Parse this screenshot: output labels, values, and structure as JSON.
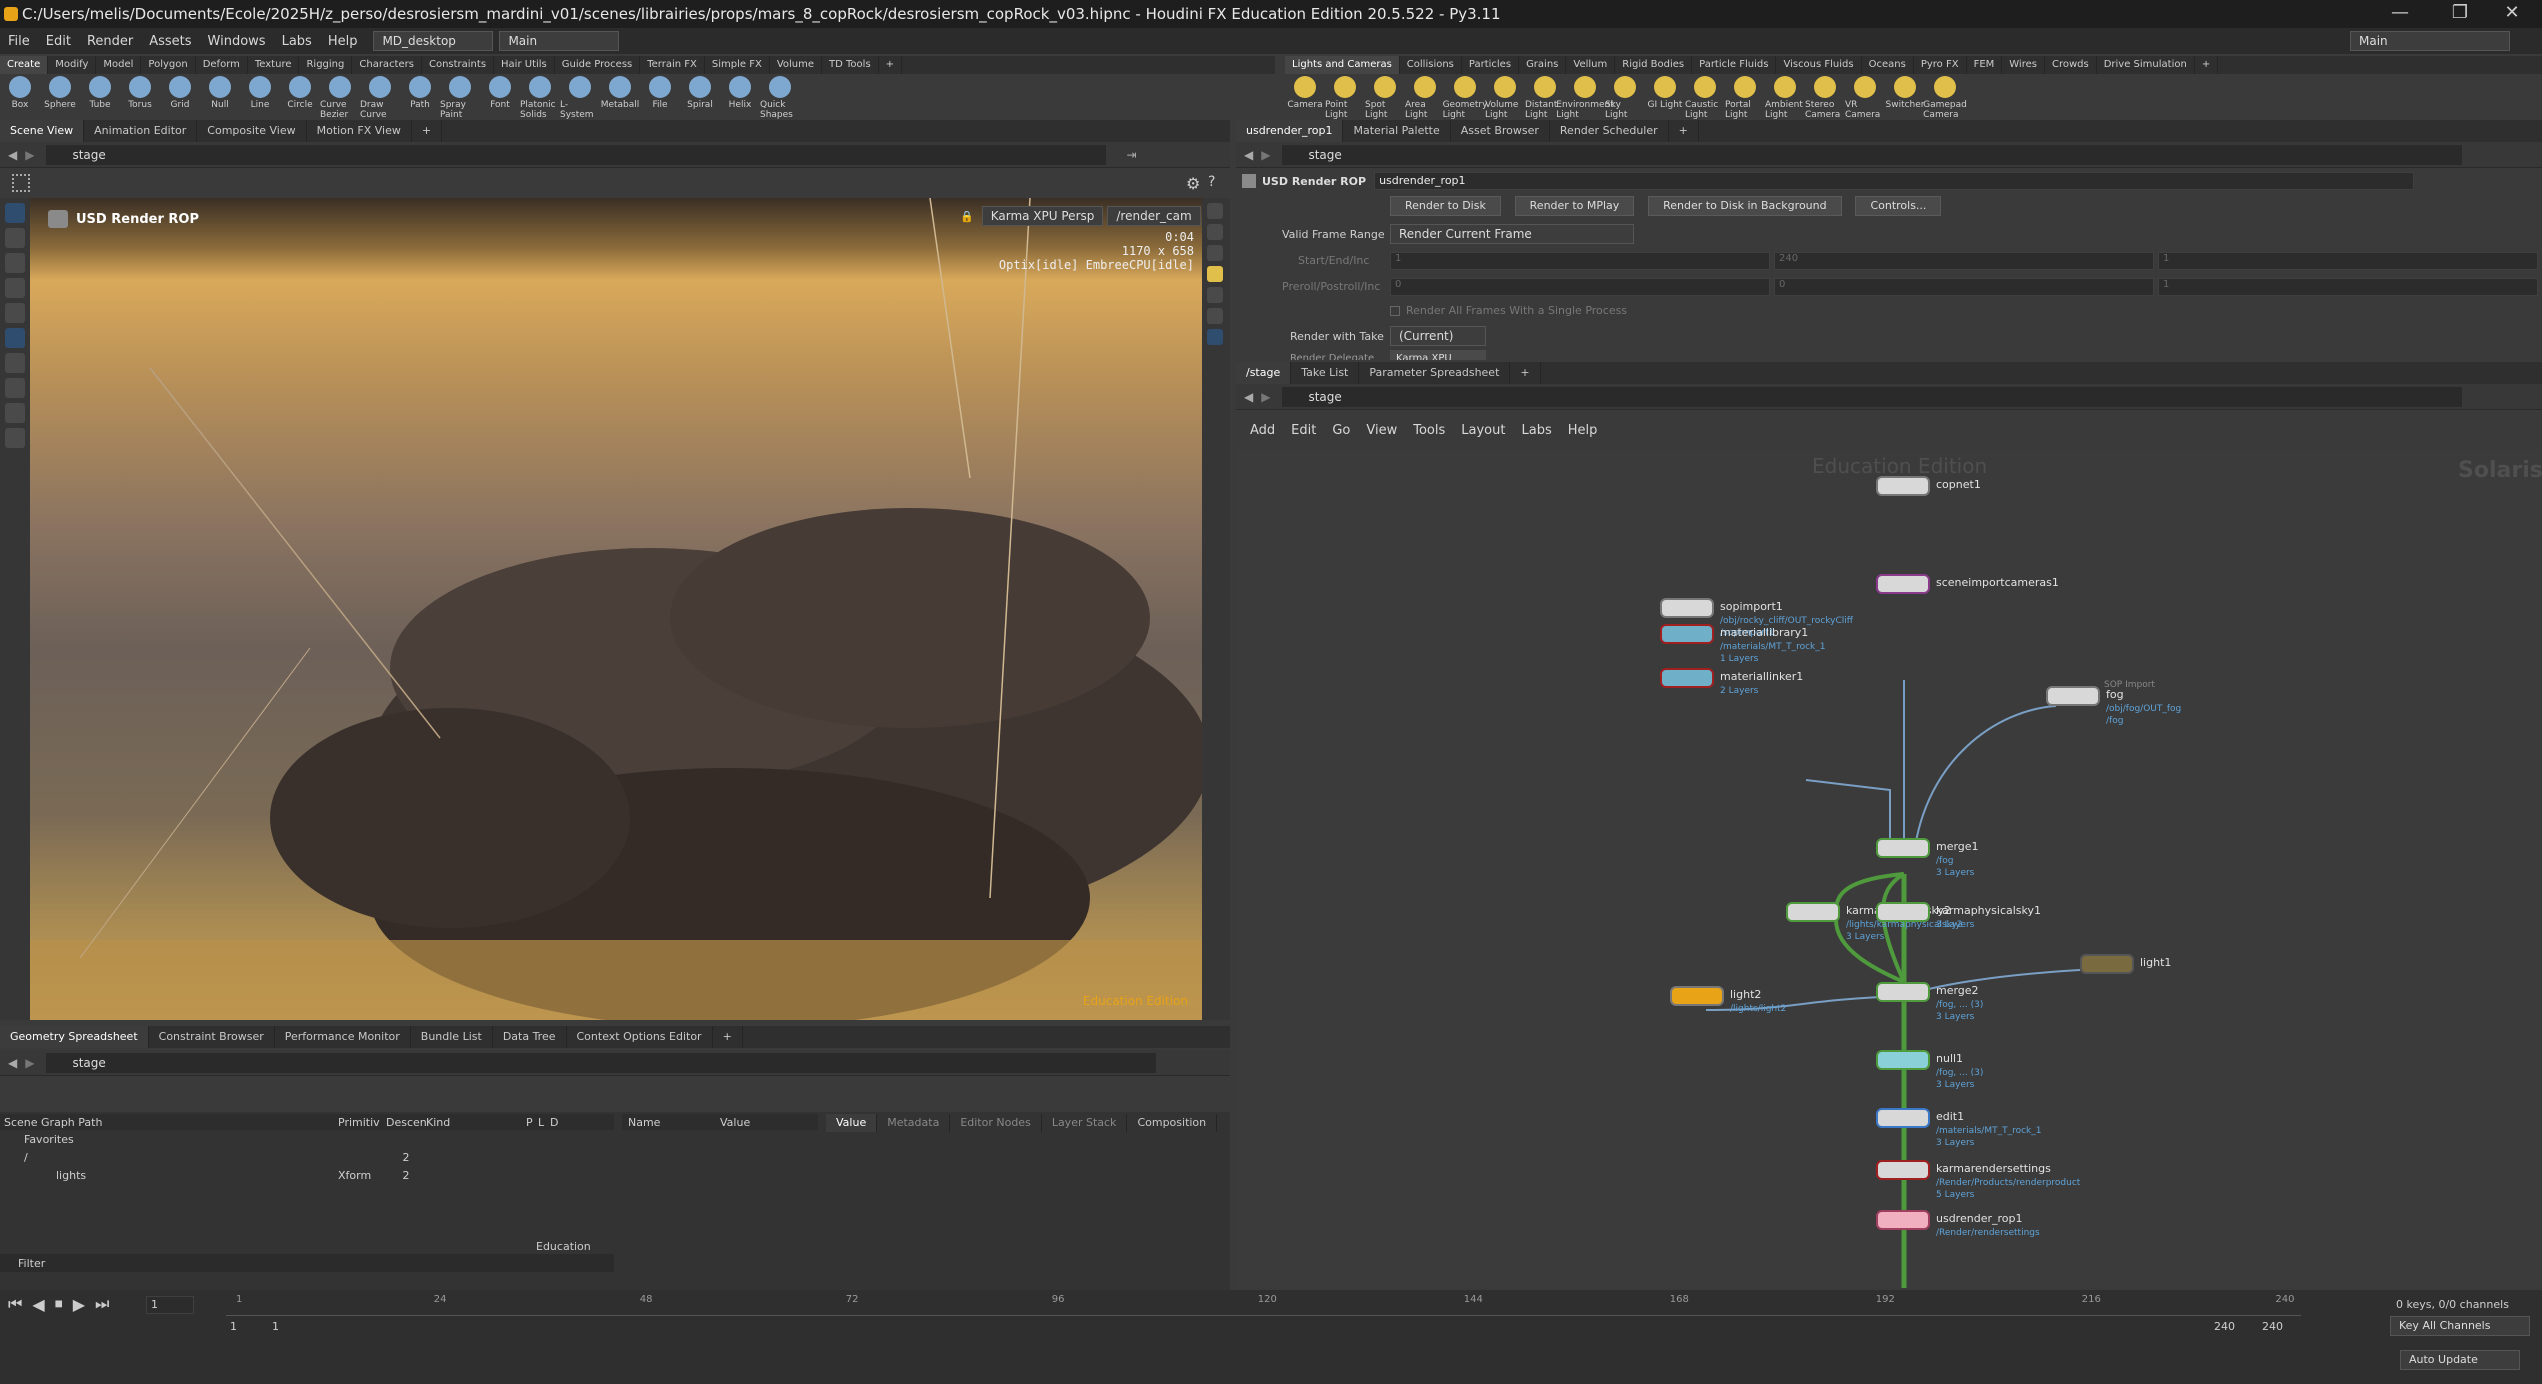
{
  "title": "C:/Users/melis/Documents/Ecole/2025H/z_perso/desrosiersm_mardini_v01/scenes/librairies/props/mars_8_copRock/desrosiersm_copRock_v03.hipnc - Houdini FX Education Edition 20.5.522 - Py3.11",
  "window_controls": [
    "—",
    "❐",
    "✕"
  ],
  "menu": [
    "File",
    "Edit",
    "Render",
    "Assets",
    "Windows",
    "Labs",
    "Help"
  ],
  "desktop": "MD_desktop",
  "main_sel": "Main",
  "main_right": "Main",
  "shelf_tabs_left": [
    "Create",
    "Modify",
    "Model",
    "Polygon",
    "Deform",
    "Texture",
    "Rigging",
    "Characters",
    "Constraints",
    "Hair Utils",
    "Guide Process",
    "Terrain FX",
    "Simple FX",
    "Volume",
    "TD Tools"
  ],
  "shelf_tabs_right": [
    "Lights and Cameras",
    "Collisions",
    "Particles",
    "Grains",
    "Vellum",
    "Rigid Bodies",
    "Particle Fluids",
    "Viscous Fluids",
    "Oceans",
    "Pyro FX",
    "FEM",
    "Wires",
    "Crowds",
    "Drive Simulation"
  ],
  "tools_left": [
    "Box",
    "Sphere",
    "Tube",
    "Torus",
    "Grid",
    "Null",
    "Line",
    "Circle",
    "Curve Bezier",
    "Draw Curve",
    "Path",
    "Spray Paint",
    "Font",
    "Platonic Solids",
    "L-System",
    "Metaball",
    "File",
    "Spiral",
    "Helix",
    "Quick Shapes"
  ],
  "tools_right": [
    "Camera",
    "Point Light",
    "Spot Light",
    "Area Light",
    "Geometry Light",
    "Volume Light",
    "Distant Light",
    "Environment Light",
    "Sky Light",
    "GI Light",
    "Caustic Light",
    "Portal Light",
    "Ambient Light",
    "Stereo Camera",
    "VR Camera",
    "Switcher",
    "Gamepad Camera"
  ],
  "colors": {
    "tool_left": "#7fa8d0",
    "tool_right": "#e0c04a",
    "accent": "#e8a317",
    "node_blue": "#5fa3d8",
    "wire_green": "#4f9a3c",
    "wire_blue": "#5b8fc7"
  },
  "left_tabs": [
    "Scene View",
    "Animation Editor",
    "Composite View",
    "Motion FX View"
  ],
  "stage_path": "stage",
  "viewport": {
    "title": "USD Render ROP",
    "renderer": "Karma XPU",
    "view": "Persp",
    "camera": "/render_cam",
    "time": "0:04",
    "res": "1170 x 658",
    "status": "Optix[idle] EmbreeCPU[idle]",
    "watermark": "Education Edition"
  },
  "right_tabs": [
    "usdrender_rop1",
    "Material Palette",
    "Asset Browser",
    "Render Scheduler"
  ],
  "params": {
    "type": "USD Render ROP",
    "name": "usdrender_rop1",
    "buttons": [
      "Render to Disk",
      "Render to MPlay",
      "Render to Disk in Background",
      "Controls..."
    ],
    "valid_frame_range_label": "Valid Frame Range",
    "valid_frame_range": "Render Current Frame",
    "start_end_inc": "Start/End/Inc",
    "preroll": "Preroll/Postroll/Inc",
    "start_vals": [
      "1",
      "240",
      "1"
    ],
    "pre_vals": [
      "0",
      "0",
      "1"
    ],
    "all_frames": "Render All Frames With a Single Process",
    "take_label": "Render with Take",
    "take": "(Current)",
    "cut_label": "Render Delegate",
    "cut_value": "Karma XPU"
  },
  "net_tabs": [
    "/stage",
    "Take List",
    "Parameter Spreadsheet"
  ],
  "net_menu": [
    "Add",
    "Edit",
    "Go",
    "View",
    "Tools",
    "Layout",
    "Labs",
    "Help"
  ],
  "net_watermark": "Education Edition",
  "net_context": "Solaris",
  "nodes": {
    "copnet1": "copnet1",
    "sceneimport": "sceneimportcameras1",
    "sopimport": "sopimport1",
    "sopimport_sub": "/obj/rocky_cliff/OUT_rockyCliff",
    "sopimport_sub2": "/sopimport1",
    "matlib": "materiallibrary1",
    "matlib_sub": "/materials/MT_T_rock_1",
    "matlib_sub2": "1 Layers",
    "matlinker": "materiallinker1",
    "matlinker_sub": "2 Layers",
    "fog_label": "fog",
    "fog_tag": "SOP Import",
    "fog_sub": "/obj/fog/OUT_fog",
    "fog_sub2": "/fog",
    "merge1": "merge1",
    "merge1_sub": "/fog",
    "merge1_sub2": "3 Layers",
    "karma_a": "karmaphysicalsky2",
    "karma_b": "karmaphysicalsky1",
    "karma_sub": "/lights/karmaphysicalsky2",
    "karma_sub2": "3 Layers",
    "karma_b_sub": "3 Layers",
    "light2": "light2",
    "light2_sub": "/lights/light2",
    "light1": "light1",
    "merge2": "merge2",
    "merge2_sub": "/fog, ... (3)",
    "merge2_sub2": "3 Layers",
    "null1": "null1",
    "null1_sub": "/fog, ... (3)",
    "null1_sub2": "3 Layers",
    "edit1": "edit1",
    "edit1_sub": "/materials/MT_T_rock_1",
    "edit1_sub2": "3 Layers",
    "krs": "karmarendersettings",
    "krs_sub": "/Render/Products/renderproduct",
    "krs_sub2": "5 Layers",
    "usdrop": "usdrender_rop1",
    "usdrop_sub": "/Render/rendersettings"
  },
  "bottom_tabs": [
    "Geometry Spreadsheet",
    "Constraint Browser",
    "Performance Monitor",
    "Bundle List",
    "Data Tree",
    "Context Options Editor"
  ],
  "sg": {
    "headers": [
      "Scene Graph Path",
      "Primitiv",
      "Descen",
      "Kind",
      "P",
      "L",
      "D"
    ],
    "rows": [
      {
        "path": "Favorites",
        "prim": "",
        "desc": "",
        "kind": ""
      },
      {
        "path": "/",
        "prim": "",
        "desc": "2",
        "kind": ""
      },
      {
        "path": "lights",
        "prim": "Xform",
        "desc": "2",
        "kind": ""
      }
    ],
    "filter": "Filter",
    "edu": "Education",
    "name_col": "Name",
    "value_col": "Value",
    "detail_tabs": [
      "Value",
      "Metadata",
      "Editor Nodes",
      "Layer Stack",
      "Composition"
    ]
  },
  "timeline": {
    "frame": "1",
    "ticks": [
      "1",
      "24",
      "48",
      "72",
      "96",
      "120",
      "144",
      "168",
      "192",
      "216",
      "240"
    ],
    "start": "1",
    "start2": "1",
    "end": "240",
    "end2": "240",
    "keys": "0 keys, 0/0 channels",
    "key_all": "Key All Channels",
    "auto_update": "Auto Update"
  }
}
